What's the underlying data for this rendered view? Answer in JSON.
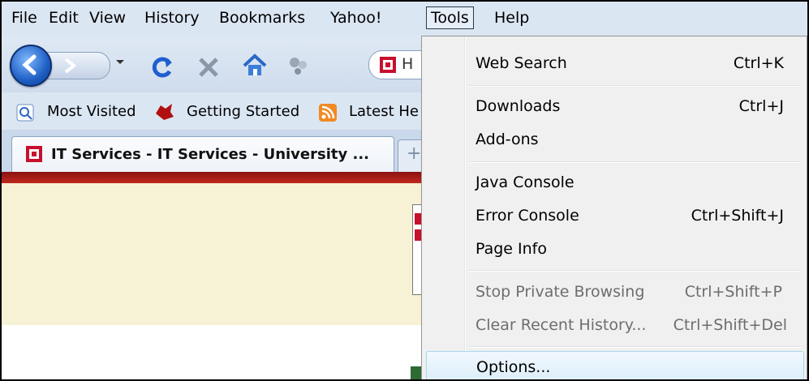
{
  "menubar": {
    "items": [
      "File",
      "Edit",
      "View",
      "History",
      "Bookmarks",
      "Yahoo!",
      "Tools",
      "Help"
    ],
    "active": "Tools"
  },
  "navbar": {
    "url_partial": "H"
  },
  "bookmarks": {
    "items": [
      "Most Visited",
      "Getting Started",
      "Latest He"
    ]
  },
  "tabs": {
    "active_title": "IT Services - IT Services - University ..."
  },
  "tools_menu": {
    "items": [
      {
        "label": "Web Search",
        "shortcut": "Ctrl+K",
        "enabled": true
      },
      {
        "label": "Downloads",
        "shortcut": "Ctrl+J",
        "enabled": true
      },
      {
        "label": "Add-ons",
        "shortcut": "",
        "enabled": true
      },
      {
        "label": "Java Console",
        "shortcut": "",
        "enabled": true
      },
      {
        "label": "Error Console",
        "shortcut": "Ctrl+Shift+J",
        "enabled": true
      },
      {
        "label": "Page Info",
        "shortcut": "",
        "enabled": true
      },
      {
        "label": "Stop Private Browsing",
        "shortcut": "Ctrl+Shift+P",
        "enabled": false
      },
      {
        "label": "Clear Recent History...",
        "shortcut": "Ctrl+Shift+Del",
        "enabled": false
      },
      {
        "label": "Options...",
        "shortcut": "",
        "enabled": true,
        "highlighted": true
      }
    ]
  },
  "colors": {
    "menu_highlight": "#dbeefa",
    "page_red": "#c0281c",
    "page_bg": "#f7f2d5"
  }
}
